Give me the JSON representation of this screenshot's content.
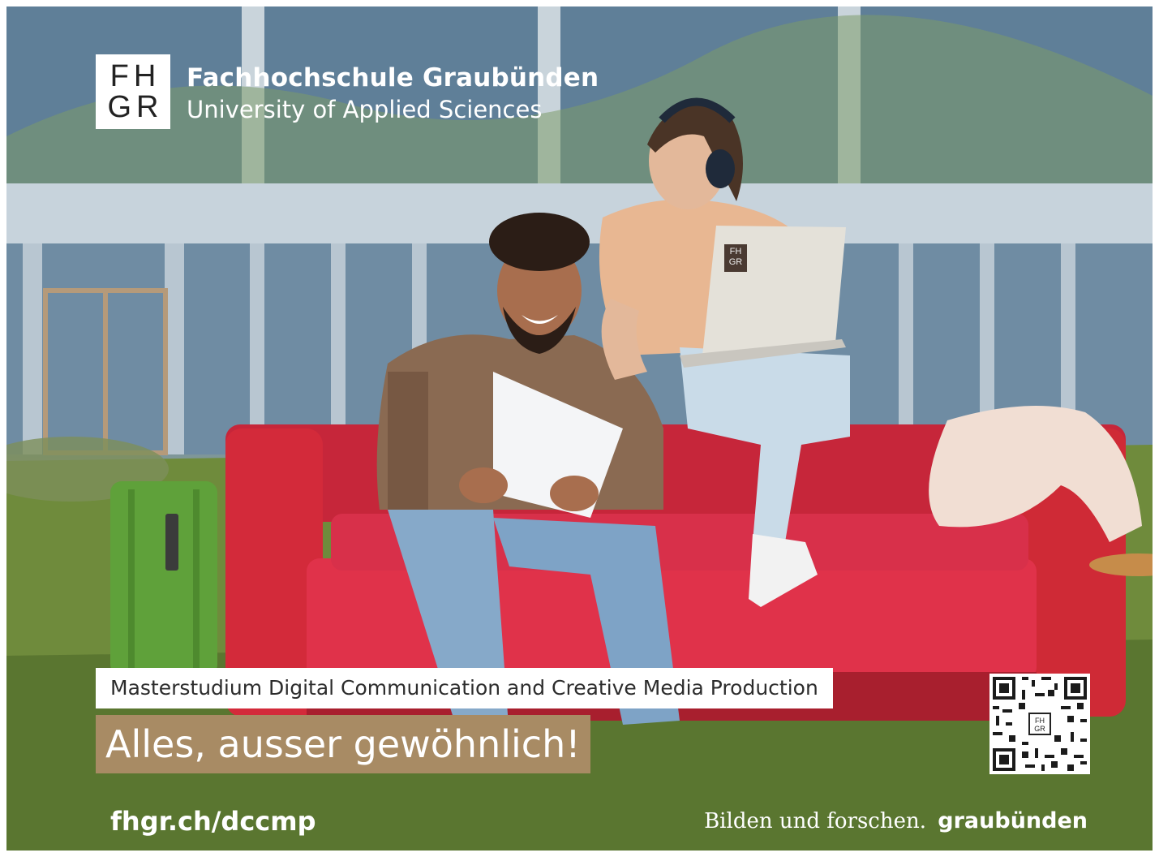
{
  "logo": {
    "mark_line1": "FH",
    "mark_line2": "GR",
    "name": "Fachhochschule Graubünden",
    "subtitle": "University of Applied Sciences"
  },
  "laptop_logo": {
    "line1": "FH",
    "line2": "GR"
  },
  "program": "Masterstudium Digital Communication and Creative Media Production",
  "slogan": "Alles, ausser gewöhnlich!",
  "url": "fhgr.ch/dccmp",
  "claim": {
    "text": "Bilden und forschen.",
    "brand": "graubünden"
  },
  "qr": {
    "center_line1": "FH",
    "center_line2": "GR"
  },
  "colors": {
    "slogan_bg": "#a88b64",
    "sofa": "#d32a3a",
    "suitcase": "#5fa13a",
    "grass": "#6e8a3e"
  },
  "icons": [
    "qr-code-icon",
    "fhgr-logo-icon",
    "graubuenden-logo-icon"
  ]
}
